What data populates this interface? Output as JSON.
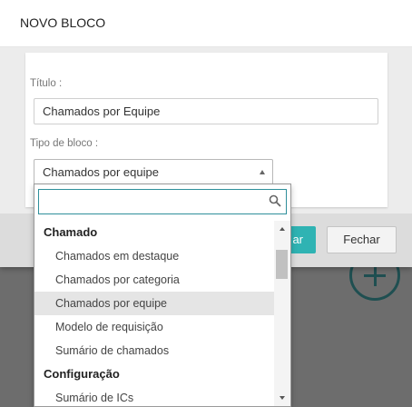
{
  "modal": {
    "title": "NOVO BLOCO",
    "fields": {
      "titulo_label": "Título :",
      "titulo_value": "Chamados por Equipe",
      "tipo_label": "Tipo de bloco :",
      "tipo_value": "Chamados por equipe"
    },
    "footer": {
      "primary_label": "ar",
      "close_label": "Fechar"
    }
  },
  "dropdown": {
    "search_placeholder": "",
    "groups": [
      {
        "label": "Chamado",
        "options": [
          "Chamados em destaque",
          "Chamados por categoria",
          "Chamados por equipe",
          "Modelo de requisição",
          "Sumário de chamados"
        ]
      },
      {
        "label": "Configuração",
        "options": [
          "Sumário de ICs"
        ]
      }
    ],
    "selected": "Chamados por equipe"
  },
  "colors": {
    "accent": "#2fb3b3",
    "overlay": "#6d6d6d",
    "selected_row": "#e5e5e5",
    "search_border": "#2f8f9b"
  },
  "icons": [
    "search-icon",
    "chevron-up-icon",
    "chevron-down-icon",
    "plus-icon"
  ]
}
